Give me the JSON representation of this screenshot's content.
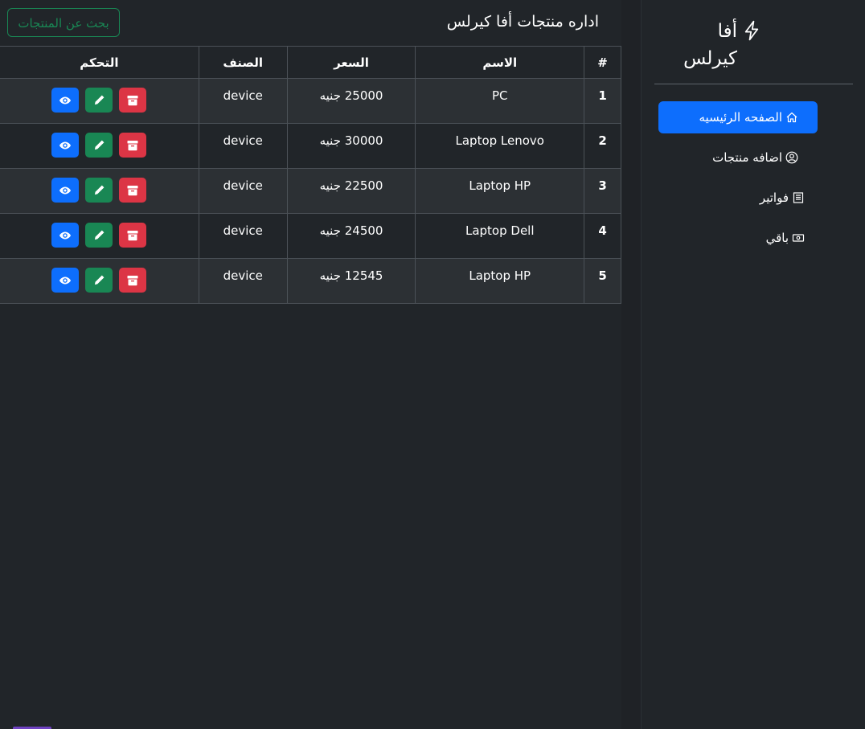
{
  "header": {
    "title": "اداره منتجات أفا كيرلس",
    "search_label": "بحث عن المنتجات"
  },
  "table": {
    "columns": [
      "#",
      "الاسم",
      "السعر",
      "الصنف",
      "التحكم"
    ],
    "rows": [
      {
        "index": "1",
        "name": "PC",
        "price": "25000 جنيه",
        "category": "device"
      },
      {
        "index": "2",
        "name": "Laptop Lenovo",
        "price": "30000 جنيه",
        "category": "device"
      },
      {
        "index": "3",
        "name": "Laptop HP",
        "price": "22500 جنيه",
        "category": "device"
      },
      {
        "index": "4",
        "name": "Laptop Dell",
        "price": "24500 جنيه",
        "category": "device"
      },
      {
        "index": "5",
        "name": "Laptop HP",
        "price": "12545 جنيه",
        "category": "device"
      }
    ],
    "action_icons": [
      "eye-icon",
      "pencil-icon",
      "archive-icon"
    ]
  },
  "sidebar": {
    "brand_line1": "أفا",
    "brand_line2": "كيرلس",
    "brand_icon": "lightning-icon",
    "items": [
      {
        "label": "الصفحه الرئيسيه",
        "icon": "house-icon",
        "active": true
      },
      {
        "label": "اضافه منتجات",
        "icon": "person-circle-icon",
        "active": false
      },
      {
        "label": "فواتير",
        "icon": "receipt-icon",
        "active": false
      },
      {
        "label": "باقي",
        "icon": "cash-icon",
        "active": false
      }
    ]
  },
  "colors": {
    "background": "#212529",
    "primary": "#0d6efd",
    "success": "#198754",
    "danger": "#dc3545"
  }
}
